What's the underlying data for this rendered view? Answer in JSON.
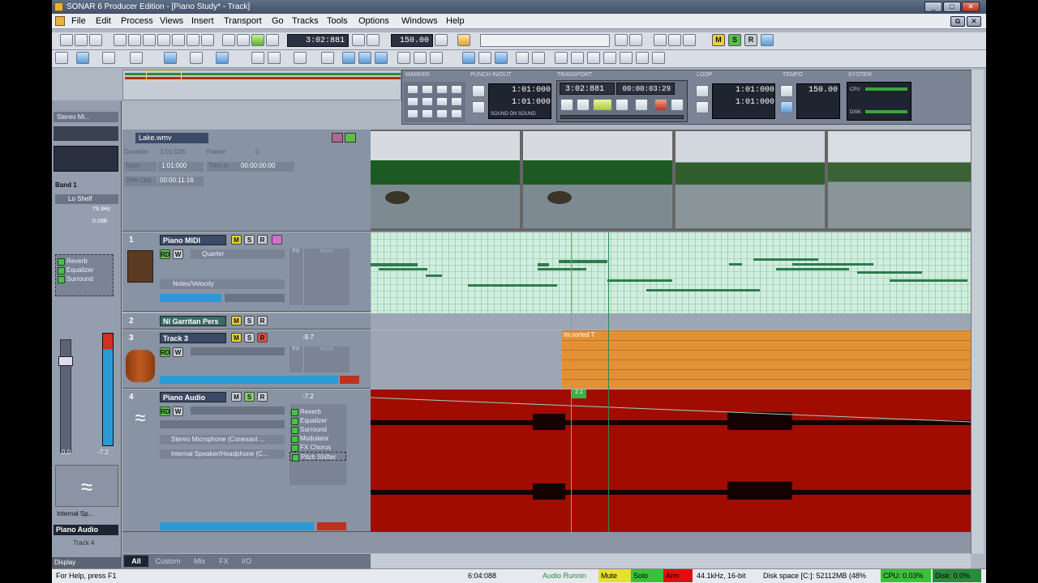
{
  "window": {
    "title": "SONAR 6 Producer Edition - [Piano Study* - Track]",
    "min": "_",
    "max": "□",
    "close": "✕",
    "doc_close": "✕",
    "doc_restore": "⧉"
  },
  "menu": [
    "File",
    "Edit",
    "Process",
    "Views",
    "Insert",
    "Transport",
    "Go",
    "Tracks",
    "Tools",
    "Options",
    "Windows",
    "Help"
  ],
  "toolbar": {
    "time": "3:02:881",
    "tempo": "150.00",
    "m": "M",
    "s": "S",
    "r": "R"
  },
  "control_bar": {
    "sections": [
      "MARKER",
      "PUNCH IN/OUT",
      "TRANSPORT",
      "LOOP",
      "TEMPO",
      "SYSTEM"
    ],
    "punch_in": "1:01:000",
    "punch_out": "1:01:000",
    "punch_mode": "SOUND ON SOUND",
    "transport_time": "3:02:881",
    "transport_smpte": "00:00:03:29",
    "loop_start": "1:01:000",
    "loop_end": "1:01:000",
    "tempo": "150.00",
    "cpu": "CPU",
    "disk": "DISK"
  },
  "video": {
    "name": "Lake.wmv",
    "duration_label": "Duration",
    "duration": "1:01:026",
    "frame_label": "Frame",
    "frame": "0",
    "start_label": "Start",
    "start": "1:01:000",
    "trim_in_label": "Trim-In",
    "trim_in": "00:00:00:00",
    "trim_out_label": "Trim-Out",
    "trim_out": "00:00:11:16"
  },
  "inspector": {
    "stereo": "Stereo Mi...",
    "band": "Band 1",
    "shelf": "Lo Shelf",
    "freq": "79.3Hz",
    "gain": "0.0dB",
    "fx": [
      "Reverb",
      "Equalizer",
      "Surround"
    ],
    "vol": "0.0",
    "vol2": "-7.2",
    "out": "Internal Sp...",
    "track_name": "Piano Audio",
    "track_num": "Track 4",
    "display": "Display"
  },
  "tracks": [
    {
      "num": "1",
      "name": "Piano MIDI",
      "rd": "RD",
      "w": "W",
      "quant": "Quarter",
      "notes": "Notes/Velocity",
      "m": "M",
      "s": "S",
      "r": "R",
      "fx": "FX",
      "none": "None"
    },
    {
      "num": "2",
      "name": "NI Garritan Pers",
      "m": "M",
      "s": "S",
      "r": "R"
    },
    {
      "num": "3",
      "name": "Track 3",
      "vol": "-9.7",
      "clip": "Imported T",
      "rd": "RD",
      "w": "W",
      "fx": "FX",
      "none": "None",
      "m": "M",
      "s": "S",
      "r": "R"
    },
    {
      "num": "4",
      "name": "Piano Audio",
      "vol": "-7.2",
      "rd": "RD",
      "w": "W",
      "in": "Stereo Microphone (Conexant ...",
      "out": "Internal Speaker/Headphone (C...",
      "fx": [
        "Reverb",
        "Equalizer",
        "Surround",
        "Modulator",
        "FX Chorus",
        "Pitch Shifter"
      ],
      "marker": "2.1",
      "m": "M",
      "s": "S",
      "r": "R"
    }
  ],
  "tabs": [
    "All",
    "Custom",
    "Mix",
    "FX",
    "I/O"
  ],
  "status": {
    "help": "For Help, press F1",
    "time": "6:04:088",
    "running": "Audio Runnin",
    "mute": "Mute",
    "solo": "Solo",
    "arm": "Arm",
    "rate": "44.1kHz, 16-bit",
    "disk": "Disk space [C:]: 52112MB (48%",
    "cpu": "CPU: 0.03%",
    "dio": "Disk: 0.0%"
  },
  "colors": {
    "midi_bg": "#cfeedd",
    "orange": "#e39135",
    "audio_red": "#a10c00"
  }
}
